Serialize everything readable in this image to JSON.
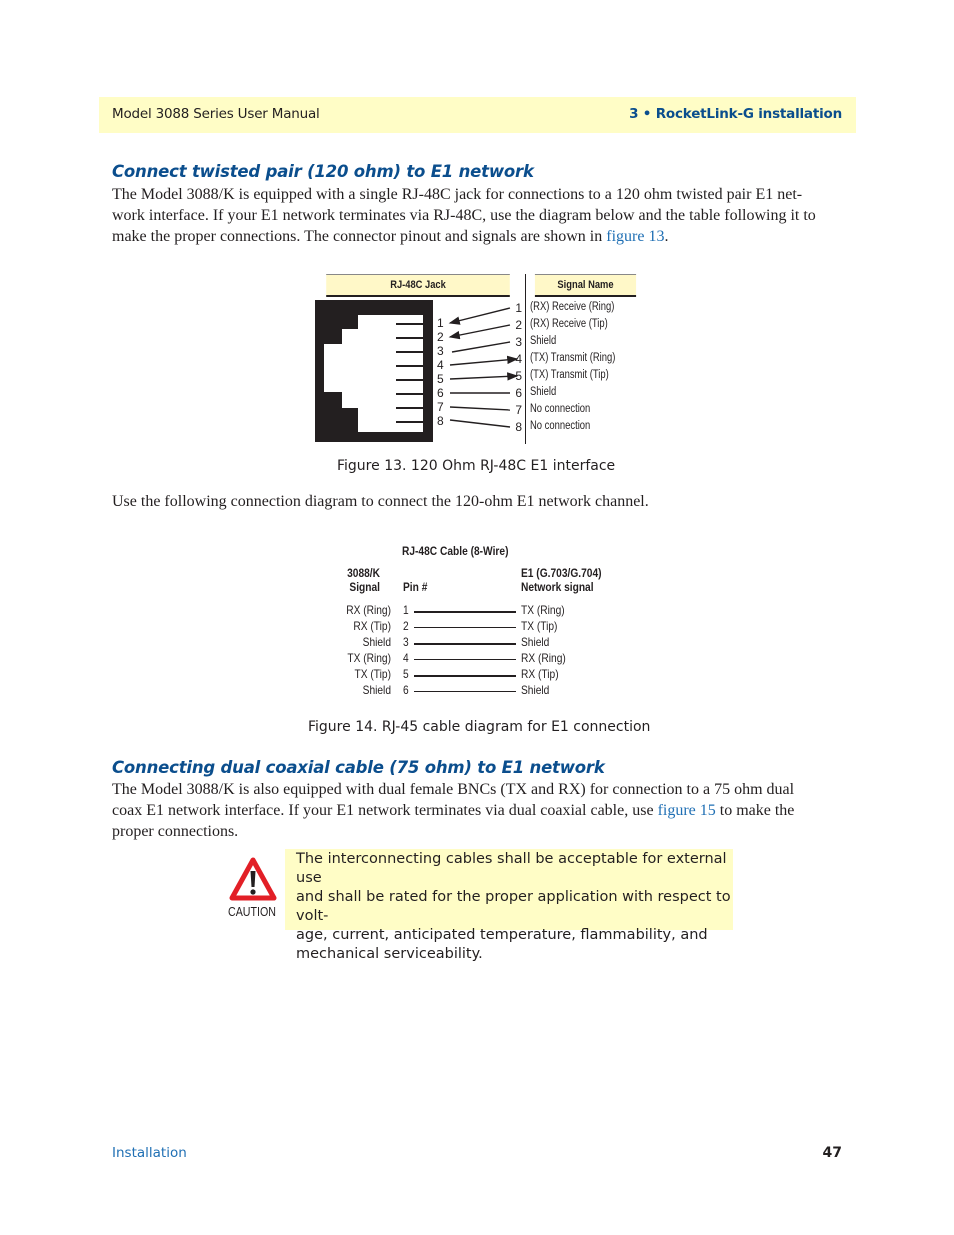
{
  "header": {
    "manual_title": "Model 3088 Series User Manual",
    "chapter": "3 • RocketLink-G installation"
  },
  "section1": {
    "heading": "Connect twisted pair (120 ohm) to E1 network",
    "para_lines": [
      "The Model 3088/K is equipped with a single RJ-48C jack for connections to a 120 ohm twisted pair E1 net-",
      "work interface. If your E1 network terminates via RJ-48C, use the diagram below and the table following it to"
    ],
    "para_last_prefix": "make the proper connections. The connector pinout and signals are shown in ",
    "para_link": "figure 13",
    "para_last_suffix": "."
  },
  "figure13": {
    "col_jack": "RJ-48C Jack",
    "col_signal": "Signal Name",
    "jack_pins": [
      "1",
      "2",
      "3",
      "4",
      "5",
      "6",
      "7",
      "8"
    ],
    "rows": [
      {
        "pin": "1",
        "signal": "(RX) Receive (Ring)"
      },
      {
        "pin": "2",
        "signal": "(RX) Receive (Tip)"
      },
      {
        "pin": "3",
        "signal": "Shield"
      },
      {
        "pin": "4",
        "signal": "(TX) Transmit (Ring)"
      },
      {
        "pin": "5",
        "signal": "(TX) Transmit (Tip)"
      },
      {
        "pin": "6",
        "signal": "Shield"
      },
      {
        "pin": "7",
        "signal": "No connection"
      },
      {
        "pin": "8",
        "signal": "No connection"
      }
    ],
    "caption": "Figure 13. 120 Ohm RJ-48C E1 interface"
  },
  "between_text": "Use the following connection diagram to connect the 120-ohm E1 network channel.",
  "figure14": {
    "title": "RJ-48C Cable (8-Wire)",
    "left_header_1": "3088/K",
    "left_header_2": "Signal",
    "pin_header": "Pin #",
    "right_header_1": "E1 (G.703/G.704)",
    "right_header_2": "Network signal",
    "rows": [
      {
        "left": "RX (Ring)",
        "pin": "1",
        "right": "TX (Ring)"
      },
      {
        "left": "RX (Tip)",
        "pin": "2",
        "right": "TX (Tip)"
      },
      {
        "left": "Shield",
        "pin": "3",
        "right": "Shield"
      },
      {
        "left": "TX (Ring)",
        "pin": "4",
        "right": "RX (Ring)"
      },
      {
        "left": "TX (Tip)",
        "pin": "5",
        "right": "RX (Tip)"
      },
      {
        "left": "Shield",
        "pin": "6",
        "right": "Shield"
      }
    ],
    "caption": "Figure 14. RJ-45 cable diagram for E1 connection"
  },
  "section2": {
    "heading": "Connecting dual coaxial cable (75 ohm) to E1 network",
    "line1": "The Model 3088/K is also equipped with dual female BNCs (TX and RX) for connection to a 75 ohm dual",
    "line2_prefix": "coax E1 network interface. If your E1 network terminates via dual coaxial cable, use ",
    "line2_link": "figure 15",
    "line2_suffix": " to make the",
    "line3": "proper connections."
  },
  "caution": {
    "label": "CAUTION",
    "icon": "warning-triangle-icon",
    "lines": [
      "The interconnecting cables shall be acceptable for external use",
      "and shall be rated for the proper application with respect to volt-",
      "age, current, anticipated temperature, flammability, and",
      "mechanical serviceability."
    ]
  },
  "footer": {
    "section": "Installation",
    "page_number": "47"
  }
}
